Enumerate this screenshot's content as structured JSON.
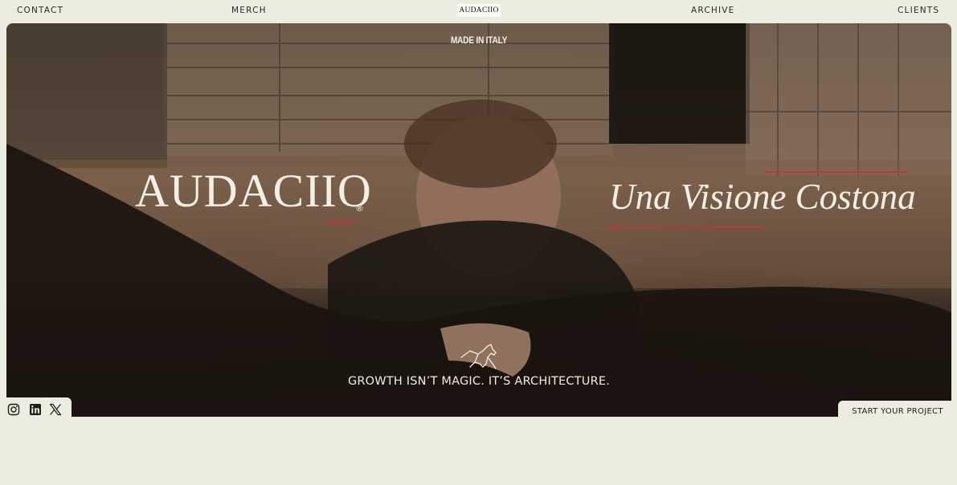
{
  "nav": {
    "contact": "CONTACT",
    "merch": "MERCH",
    "logo": "AUDACIIO",
    "archive": "ARCHIVE",
    "clients": "CLIENTS"
  },
  "hero": {
    "made_in": "MADE IN ITALY",
    "brand": "AUDACIIO",
    "registered": "®",
    "studio": "STUDIO",
    "tagline": "Una Visione Costona",
    "slogan": "GROWTH ISN’T MAGIC. IT’S ARCHITECTURE."
  },
  "social": {
    "icons": [
      "instagram-icon",
      "linkedin-icon",
      "x-icon"
    ]
  },
  "cta": {
    "label": "START YOUR PROJECT"
  },
  "colors": {
    "background": "#edece1",
    "accent_red": "#c4323a",
    "hero_text": "#f4efe4"
  }
}
